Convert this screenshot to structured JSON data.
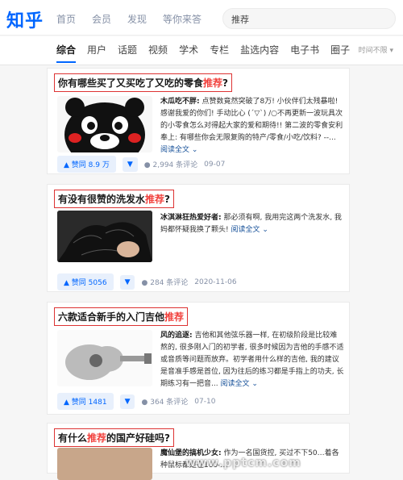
{
  "header": {
    "logo": "知乎",
    "nav": [
      "首页",
      "会员",
      "发现",
      "等你来答"
    ],
    "search_value": "推荐"
  },
  "tabs": [
    "综合",
    "用户",
    "话题",
    "视频",
    "学术",
    "专栏",
    "盐选内容",
    "电子书",
    "圈子"
  ],
  "time_filter": "时间不限",
  "results": [
    {
      "title_pre": "你有哪些买了又买吃了又吃的零食",
      "title_kw": "推荐",
      "title_post": "?",
      "author": "木瓜吃不胖:",
      "excerpt": "点赞数竟然突破了8万! 小伙伴们太残暴啦! 感谢我爱的你们! 手动比心 (´▽`) /○不再更新一波玩具次的小零食怎么对得起大家的爱和期待!! 第二波的零食安利奉上: 有哪些你会无限复购的特产/零食/小吃/饮料? --...",
      "read_more": "阅读全文",
      "votes": "赞同 8.9 万",
      "comments": "2,994 条评论",
      "date": "09-07"
    },
    {
      "title_pre": "有没有很赞的洗发水",
      "title_kw": "推荐",
      "title_post": "?",
      "author": "冰淇淋狂热爱好者:",
      "excerpt": "那必须有啊, 我用完这两个洗发水, 我妈都怀疑我换了颗头!",
      "read_more": "阅读全文",
      "votes": "赞同 5056",
      "comments": "284 条评论",
      "date": "2020-11-06"
    },
    {
      "title_pre": "六款适合新手的入门吉他",
      "title_kw": "推荐",
      "title_post": "",
      "author": "风的追逐:",
      "excerpt": "吉他和其他弦乐器一样, 在初级阶段是比较难熬的, 很多刚入门的初学者, 很多时候因为吉他的手感不适或音质等问题而放弃。初学者用什么样的吉他, 我的建议是音准手感是首位, 因为往后的练习都是手指上的功夫, 长期练习有一把音...",
      "read_more": "阅读全文",
      "votes": "赞同 1481",
      "comments": "364 条评论",
      "date": "07-10"
    },
    {
      "title_pre": "有什么",
      "title_kw": "推荐",
      "title_post": "的国产好硅吗?",
      "author": "魔仙堡的搞机少女:",
      "excerpt": "作为一名国货控, 买过不下50…着各种鼠标都是在100-…",
      "read_more": "",
      "votes": "",
      "comments": "",
      "date": ""
    }
  ],
  "watermark": "www.pptcm.com"
}
